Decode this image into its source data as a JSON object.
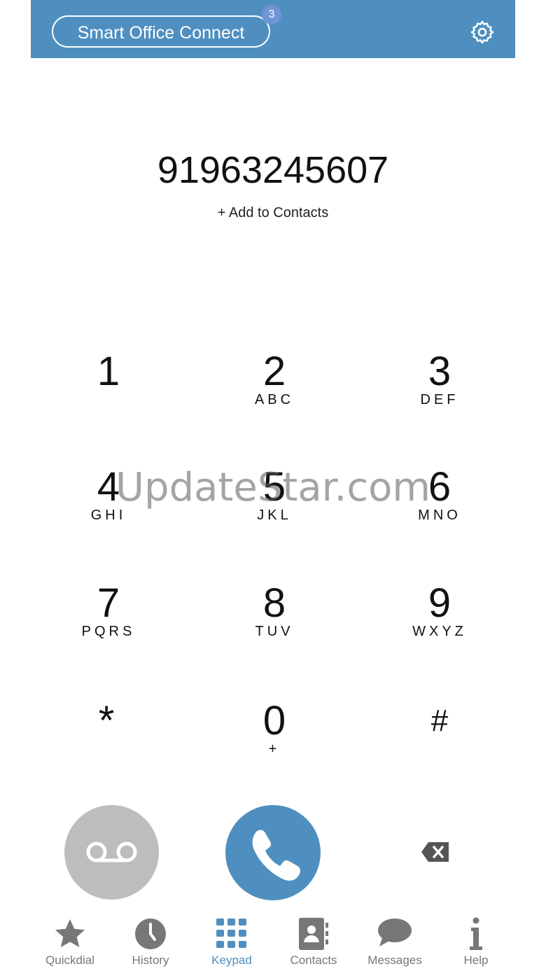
{
  "header": {
    "app_title": "Smart Office Connect",
    "badge_count": "3",
    "settings_icon": "gear-icon"
  },
  "dialer": {
    "number": "91963245607",
    "add_to_contacts": "+ Add to Contacts"
  },
  "watermark": "UpdateStar.com",
  "keypad": [
    {
      "digit": "1",
      "letters": ""
    },
    {
      "digit": "2",
      "letters": "ABC"
    },
    {
      "digit": "3",
      "letters": "DEF"
    },
    {
      "digit": "4",
      "letters": "GHI"
    },
    {
      "digit": "5",
      "letters": "JKL"
    },
    {
      "digit": "6",
      "letters": "MNO"
    },
    {
      "digit": "7",
      "letters": "PQRS"
    },
    {
      "digit": "8",
      "letters": "TUV"
    },
    {
      "digit": "9",
      "letters": "WXYZ"
    },
    {
      "digit": "*",
      "letters": ""
    },
    {
      "digit": "0",
      "letters": "+"
    },
    {
      "digit": "#",
      "letters": ""
    }
  ],
  "actions": {
    "voicemail_icon": "voicemail-icon",
    "call_icon": "phone-icon",
    "backspace_icon": "backspace-icon"
  },
  "tabs": [
    {
      "label": "Quickdial",
      "icon": "star-icon"
    },
    {
      "label": "History",
      "icon": "clock-icon"
    },
    {
      "label": "Keypad",
      "icon": "keypad-grid-icon",
      "active": true
    },
    {
      "label": "Contacts",
      "icon": "contact-book-icon"
    },
    {
      "label": "Messages",
      "icon": "chat-bubble-icon"
    },
    {
      "label": "Help",
      "icon": "info-icon"
    }
  ],
  "colors": {
    "accent": "#4f8fc0",
    "voicemail_button": "#bdbdbd",
    "tab_inactive": "#777777"
  }
}
